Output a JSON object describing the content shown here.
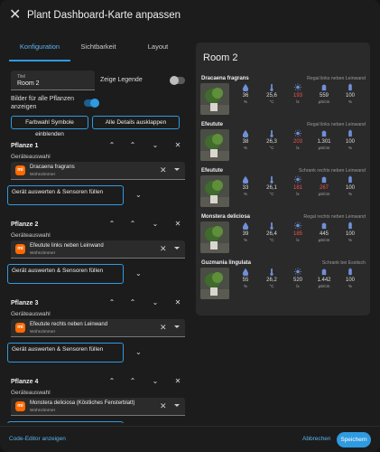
{
  "dialog": {
    "title": "Plant Dashboard-Karte anpassen"
  },
  "tabs": [
    {
      "label": "Konfiguration",
      "active": true
    },
    {
      "label": "Sichtbarkeit",
      "active": false
    },
    {
      "label": "Layout",
      "active": false
    }
  ],
  "editor": {
    "title_field": {
      "label": "Titel",
      "value": "Room 2"
    },
    "legend": {
      "label": "Zeige Legende",
      "enabled": false
    },
    "images": {
      "label": "Bilder für alle Pflanzen anzeigen",
      "enabled": true
    },
    "btn_colors": "Farbwahl Symbole einblenden",
    "btn_expand": "Alle Details ausklappen",
    "device_label": "Geräteauswahl",
    "evaluate_label": "Gerät auswerten & Sensoren füllen",
    "plants": [
      {
        "title": "Pflanze 1",
        "device": "Dracaena fragrans",
        "area": "Wohnzimmer"
      },
      {
        "title": "Pflanze 2",
        "device": "Efeutute links neben Leinwand",
        "area": "Wohnzimmer"
      },
      {
        "title": "Pflanze 3",
        "device": "Efeutute rechts neben Leinwand",
        "area": "Wohnzimmer"
      },
      {
        "title": "Pflanze 4",
        "device": "Monstera deliciosa (Köstliches Fensterblatt)",
        "area": "Wohnzimmer"
      }
    ]
  },
  "card": {
    "title": "Room 2",
    "sensor_icons": [
      "water-drop-icon",
      "thermometer-icon",
      "sun-icon",
      "fertilizer-icon",
      "battery-icon"
    ],
    "units": [
      "%",
      "°C",
      "lx",
      "µS/cm",
      "%"
    ],
    "plants": [
      {
        "name": "Dracaena fragrans",
        "location": "Regal links neben Leinwand",
        "values": [
          "36",
          "25,6",
          "193",
          "559",
          "100"
        ],
        "alerts": [
          false,
          false,
          true,
          false,
          false
        ]
      },
      {
        "name": "Efeutute",
        "location": "Regal links neben Leinwand",
        "values": [
          "38",
          "26,3",
          "203",
          "1.301",
          "100"
        ],
        "alerts": [
          false,
          false,
          true,
          false,
          false
        ]
      },
      {
        "name": "Efeutute",
        "location": "Schrank rechts neben Leinwand",
        "values": [
          "33",
          "26,1",
          "181",
          "267",
          "100"
        ],
        "alerts": [
          false,
          false,
          true,
          true,
          false
        ]
      },
      {
        "name": "Monstera deliciosa",
        "location": "Regal rechts neben Leinwand",
        "values": [
          "39",
          "26,4",
          "185",
          "445",
          "100"
        ],
        "alerts": [
          false,
          false,
          true,
          false,
          false
        ]
      },
      {
        "name": "Guzmania lingulata",
        "location": "Schrank bei Esstisch",
        "values": [
          "55",
          "26,2",
          "520",
          "1.442",
          "100"
        ],
        "alerts": [
          false,
          false,
          false,
          false,
          false
        ]
      }
    ]
  },
  "colors": {
    "accent": "#2f9ae0",
    "alert": "#ef5350",
    "icon": "#6f8fd8",
    "xiaomi": "#ff6900"
  },
  "footer": {
    "code_editor": "Code-Editor anzeigen",
    "cancel": "Abbrechen",
    "save": "Speichern"
  }
}
